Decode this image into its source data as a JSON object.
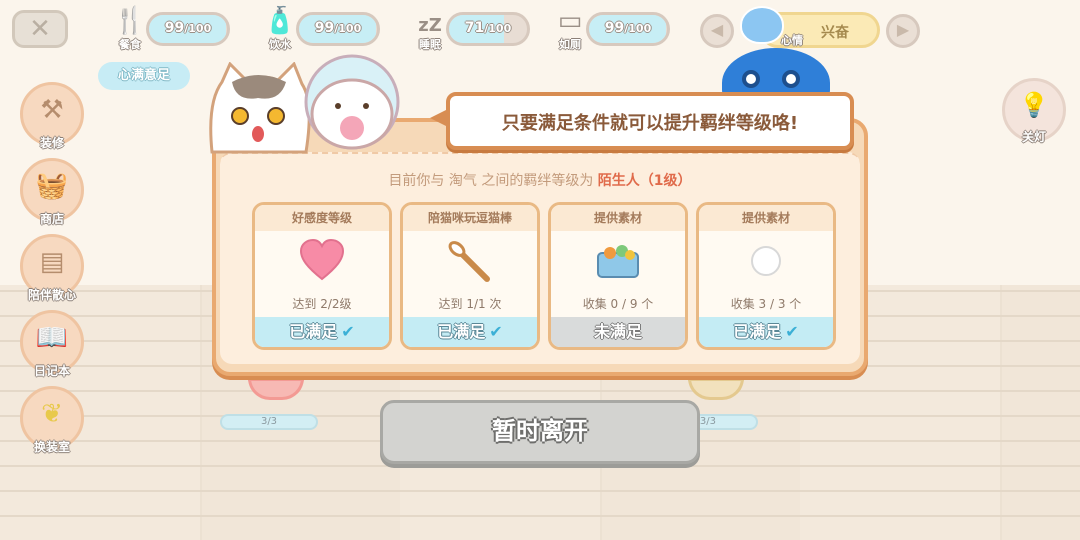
{
  "top_bar": {
    "close_label": "✕",
    "stats": [
      {
        "name": "food",
        "label": "餐食",
        "value": "99",
        "max": "/100",
        "fill": 0.99
      },
      {
        "name": "water",
        "label": "饮水",
        "value": "99",
        "max": "/100",
        "fill": 0.99
      },
      {
        "name": "sleep",
        "label": "睡眠",
        "value": "71",
        "max": "/100",
        "fill": 0.71
      },
      {
        "name": "toilet",
        "label": "如厕",
        "value": "99",
        "max": "/100",
        "fill": 0.99
      }
    ],
    "mood": {
      "label": "心情",
      "value": "兴奋",
      "prev_arrow": "◀",
      "next_arrow": "▶"
    }
  },
  "satisfied_tag": "心满意足",
  "side_menu": [
    {
      "id": "decorate",
      "label": "装修",
      "icon": "hammer-icon"
    },
    {
      "id": "shop",
      "label": "商店",
      "icon": "basket-icon"
    },
    {
      "id": "relax",
      "label": "陪伴散心",
      "icon": "scenery-icon"
    },
    {
      "id": "diary",
      "label": "日记本",
      "icon": "book-icon"
    },
    {
      "id": "wardrobe",
      "label": "换装室",
      "icon": "butterfly-icon"
    }
  ],
  "light_button": {
    "label": "关灯",
    "icon": "lamp-icon"
  },
  "bowls": {
    "left_count": "3/3",
    "right_count": "3/3"
  },
  "modal": {
    "speech": "只要满足条件就可以提升羁绊等级咯!",
    "bond_prefix": "目前你与 淘气 之间的羁绊等级为",
    "bond_level": "陌生人（1级）",
    "cards": [
      {
        "title": "好感度等级",
        "icon": "heart-icon",
        "desc": "达到 2/2级",
        "status": "已满足",
        "met": true
      },
      {
        "title": "陪猫咪玩逗猫棒",
        "icon": "cat-teaser-icon",
        "desc": "达到 1/1 次",
        "status": "已满足",
        "met": true
      },
      {
        "title": "提供素材",
        "icon": "food-tray-icon",
        "desc": "收集 0 / 9 个",
        "status": "未满足",
        "met": false
      },
      {
        "title": "提供素材",
        "icon": "cotton-ball-icon",
        "desc": "收集 3 / 3 个",
        "status": "已满足",
        "met": true
      }
    ]
  },
  "leave_button": "暂时离开",
  "colors": {
    "accent": "#e9a970",
    "met": "#c4ecf4",
    "unmet": "#d9dbdb",
    "level_red": "#e06b4b"
  }
}
